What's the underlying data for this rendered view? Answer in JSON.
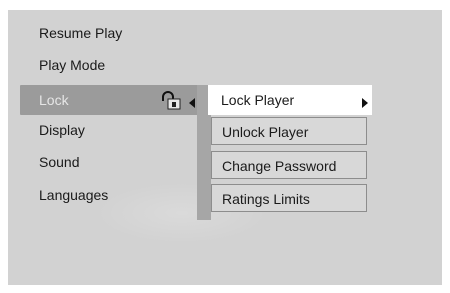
{
  "main_menu": {
    "items": [
      {
        "label": "Resume Play"
      },
      {
        "label": "Play Mode"
      },
      {
        "label": "Lock"
      },
      {
        "label": "Display"
      },
      {
        "label": "Sound"
      },
      {
        "label": "Languages"
      }
    ],
    "selected_index": 2
  },
  "lock_submenu": {
    "items": [
      {
        "label": "Lock Player"
      },
      {
        "label": "Unlock Player"
      },
      {
        "label": "Change Password"
      },
      {
        "label": "Ratings Limits"
      }
    ],
    "selected_index": 0
  },
  "icons": {
    "lock": "lock-icon",
    "submenu_left": "triangle-left-icon",
    "submenu_right": "triangle-right-icon"
  },
  "colors": {
    "panel_bg": "#d2d2d2",
    "selected_row_bg": "#9b9b9b",
    "selected_row_text": "#e6e6e6",
    "submenu_highlight": "#ffffff",
    "text": "#1a1a1a"
  }
}
